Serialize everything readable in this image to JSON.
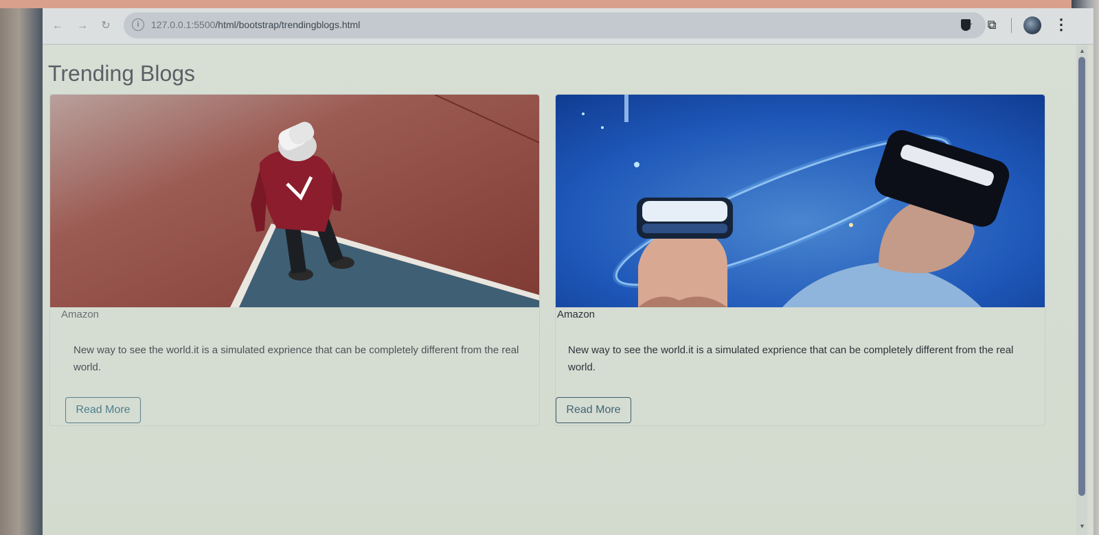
{
  "browser": {
    "url_host": "127.0.0.1:5500",
    "url_path": "/html/bootstrap/trendingblogs.html"
  },
  "page": {
    "title": "Trending Blogs"
  },
  "cards": [
    {
      "source": "Amazon",
      "text": "New way to see the world.it is a simulated exprience that can be completely different from the real world.",
      "button_label": "Read More"
    },
    {
      "source": "Amazon",
      "text": "New way to see the world.it is a simulated exprience that can be completely different from the real world.",
      "button_label": "Read More"
    }
  ],
  "colors": {
    "accent_button": "#4e7f8c",
    "page_background": "#d6dcd2"
  }
}
